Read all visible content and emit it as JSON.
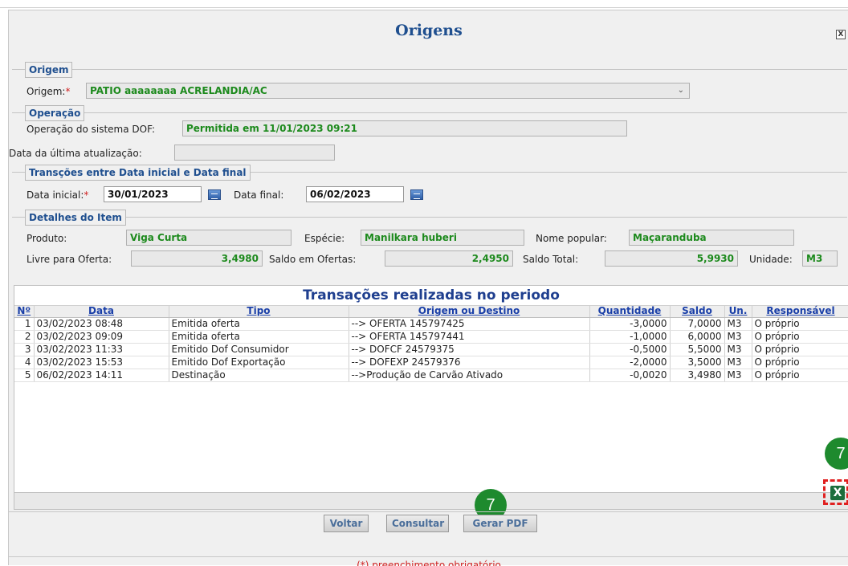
{
  "dialog": {
    "title": "Origens",
    "close_label": "X"
  },
  "origem": {
    "section_label": "Origem",
    "field_label": "Origem:",
    "required_mark": "*",
    "value": "PATIO aaaaaaaa ACRELANDIA/AC"
  },
  "operacao": {
    "section_label": "Operação",
    "field_label": "Operação do sistema DOF:",
    "value": "Permitida em 11/01/2023 09:21"
  },
  "ultima_atualizacao": {
    "label": "Data da última atualização:",
    "value": ""
  },
  "periodo": {
    "section_label": "Transções entre Data inicial e Data final",
    "inicial_label": "Data inicial:",
    "required_mark": "*",
    "inicial_value": "30/01/2023",
    "final_label": "Data final:",
    "final_value": "06/02/2023"
  },
  "detalhes": {
    "section_label": "Detalhes do Item",
    "produto_label": "Produto:",
    "produto_value": "Viga Curta",
    "especie_label": "Espécie:",
    "especie_value": "Manilkara huberi",
    "nome_popular_label": "Nome popular:",
    "nome_popular_value": "Maçaranduba",
    "livre_label": "Livre para Oferta:",
    "livre_value": "3,4980",
    "saldo_ofertas_label": "Saldo em Ofertas:",
    "saldo_ofertas_value": "2,4950",
    "saldo_total_label": "Saldo Total:",
    "saldo_total_value": "5,9930",
    "unidade_label": "Unidade:",
    "unidade_value": "M3"
  },
  "transacoes": {
    "title": "Transações realizadas no periodo",
    "columns": [
      "Nº",
      "Data",
      "Tipo",
      "Origem ou Destino",
      "Quantidade",
      "Saldo",
      "Un.",
      "Responsável"
    ],
    "rows": [
      [
        "1",
        "03/02/2023 08:48",
        "Emitida oferta",
        "--> OFERTA 145797425",
        "-3,0000",
        "7,0000",
        "M3",
        "O próprio"
      ],
      [
        "2",
        "03/02/2023 09:09",
        "Emitida oferta",
        "--> OFERTA 145797441",
        "-1,0000",
        "6,0000",
        "M3",
        "O próprio"
      ],
      [
        "3",
        "03/02/2023 11:33",
        "Emitido Dof Consumidor",
        "--> DOFCF 24579375",
        "-0,5000",
        "5,5000",
        "M3",
        "O próprio"
      ],
      [
        "4",
        "03/02/2023 15:53",
        "Emitido Dof Exportação",
        "--> DOFEXP 24579376",
        "-2,0000",
        "3,5000",
        "M3",
        "O próprio"
      ],
      [
        "5",
        "06/02/2023 14:11",
        "Destinação",
        "-->Produção de Carvão Ativado",
        "-0,0020",
        "3,4980",
        "M3",
        "O próprio"
      ]
    ]
  },
  "annotations": {
    "badge_bottom": "7",
    "badge_right": "7"
  },
  "buttons": {
    "voltar": "Voltar",
    "consultar": "Consultar",
    "gerar_pdf": "Gerar PDF",
    "excel_icon_label": "X"
  },
  "footer": {
    "note": "(*) preenchimento obrigatório"
  },
  "colors": {
    "title": "#1f4f8f",
    "field_value": "#1d8a1d",
    "badge": "#1e8a2e",
    "highlight": "#e02020"
  }
}
